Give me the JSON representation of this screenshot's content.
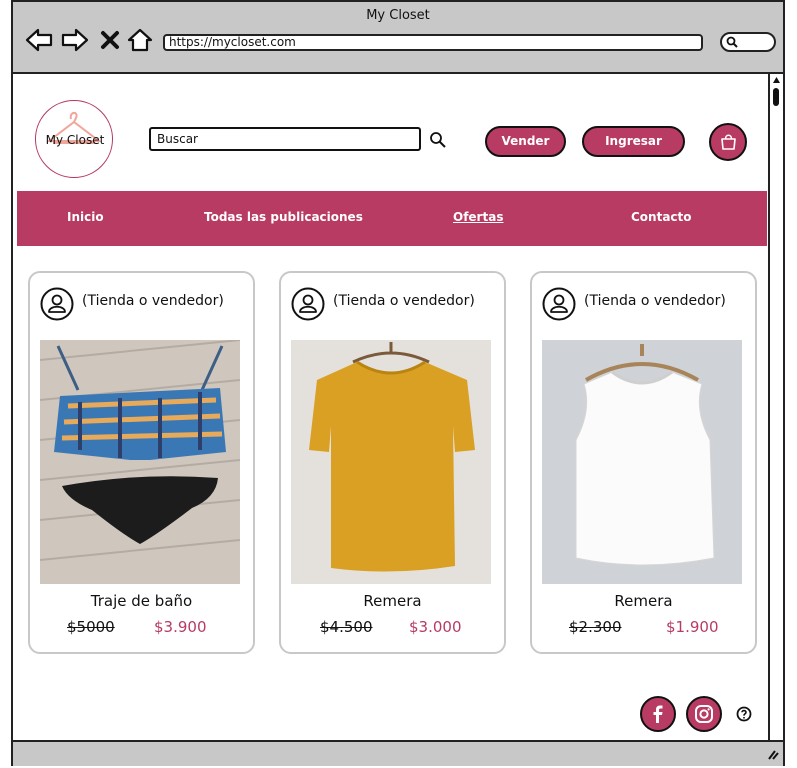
{
  "window": {
    "title": "My Closet"
  },
  "browser": {
    "url": "https://mycloset.com"
  },
  "header": {
    "logo_text": "My Closet",
    "search_placeholder": "Buscar",
    "sell_button": "Vender",
    "login_button": "Ingresar"
  },
  "nav": {
    "items": [
      {
        "label": "Inicio"
      },
      {
        "label": "Todas las publicaciones"
      },
      {
        "label": "Ofertas"
      },
      {
        "label": "Contacto"
      }
    ]
  },
  "products": [
    {
      "seller": "(Tienda o vendedor)",
      "name": "Traje de baño",
      "old_price": "$5000",
      "new_price": "$3.900",
      "photo": "swimsuit"
    },
    {
      "seller": "(Tienda o vendedor)",
      "name": "Remera",
      "old_price": "$4.500",
      "new_price": "$3.000",
      "photo": "mustard-tshirt"
    },
    {
      "seller": "(Tienda o vendedor)",
      "name": "Remera",
      "old_price": "$2.300",
      "new_price": "$1.900",
      "photo": "white-tank-top"
    }
  ],
  "colors": {
    "brand": "#b73b63",
    "chrome": "#c8c8c8",
    "card_border": "#c8c8c8"
  },
  "icons": {
    "back": "back-arrow-icon",
    "forward": "forward-arrow-icon",
    "stop": "close-icon",
    "home": "home-icon",
    "search": "search-icon",
    "cart": "shopping-bag-icon",
    "avatar": "user-icon",
    "facebook": "facebook-icon",
    "instagram": "instagram-icon",
    "help": "help-icon"
  }
}
